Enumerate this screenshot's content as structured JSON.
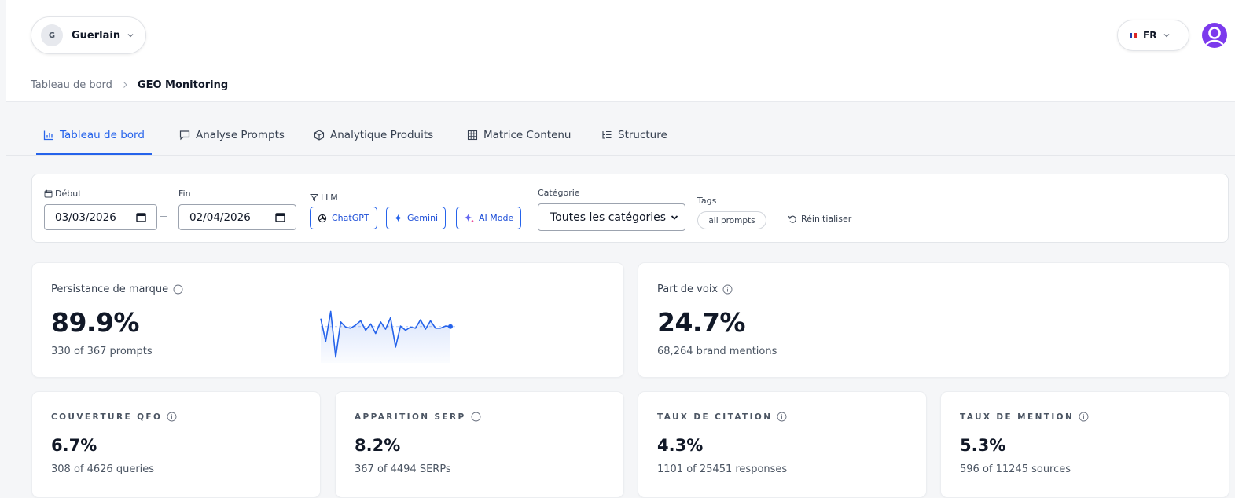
{
  "header": {
    "brand_initial": "G",
    "brand_name": "Guerlain",
    "language": "FR",
    "flag_colors": [
      "#1e40af",
      "#ffffff",
      "#dc2626"
    ],
    "avatar_color": "#7c3aed"
  },
  "breadcrumb": {
    "parent": "Tableau de bord",
    "current": "GEO Monitoring"
  },
  "tabs": [
    {
      "label": "Tableau de bord",
      "icon": "bar-chart-icon",
      "active": true
    },
    {
      "label": "Analyse Prompts",
      "icon": "message-square-icon",
      "active": false
    },
    {
      "label": "Analytique Produits",
      "icon": "package-icon",
      "active": false
    },
    {
      "label": "Matrice Contenu",
      "icon": "grid-icon",
      "active": false
    },
    {
      "label": "Structure",
      "icon": "list-tree-icon",
      "active": false
    }
  ],
  "filters": {
    "start_label": "Début",
    "start_value": "03/03/2026",
    "end_label": "Fin",
    "end_value": "02/04/2026",
    "llm_label": "LLM",
    "llm_options": [
      "ChatGPT",
      "Gemini",
      "AI Mode"
    ],
    "category_label": "Catégorie",
    "category_value": "Toutes les catégories",
    "tags_label": "Tags",
    "tag_value": "all prompts",
    "reset_label": "Réinitialiser"
  },
  "metrics": {
    "brand_persistence": {
      "title": "Persistance de marque",
      "value": "89.9%",
      "sub": "330 of 367 prompts",
      "sparkline": [
        0.78,
        0.35,
        0.92,
        0.05,
        0.72,
        0.62,
        0.6,
        0.66,
        0.74,
        0.56,
        0.68,
        0.5,
        0.72,
        0.58,
        0.8,
        0.24,
        0.64,
        0.56,
        0.62,
        0.6,
        0.76,
        0.58,
        0.74,
        0.6,
        0.6,
        0.64,
        0.63
      ],
      "sparkline_color": "#2563eb"
    },
    "share_of_voice": {
      "title": "Part de voix",
      "value": "24.7%",
      "sub": "68,264 brand mentions"
    },
    "qfo_coverage": {
      "title": "COUVERTURE QFO",
      "value": "6.7%",
      "sub": "308 of 4626 queries"
    },
    "serp_appearance": {
      "title": "APPARITION SERP",
      "value": "8.2%",
      "sub": "367 of 4494 SERPs"
    },
    "citation_rate": {
      "title": "TAUX DE CITATION",
      "value": "4.3%",
      "sub": "1101 of 25451 responses"
    },
    "mention_rate": {
      "title": "TAUX DE MENTION",
      "value": "5.3%",
      "sub": "596 of 11245 sources"
    }
  },
  "colors": {
    "accent": "#2563eb",
    "background": "#f5f6f8"
  }
}
